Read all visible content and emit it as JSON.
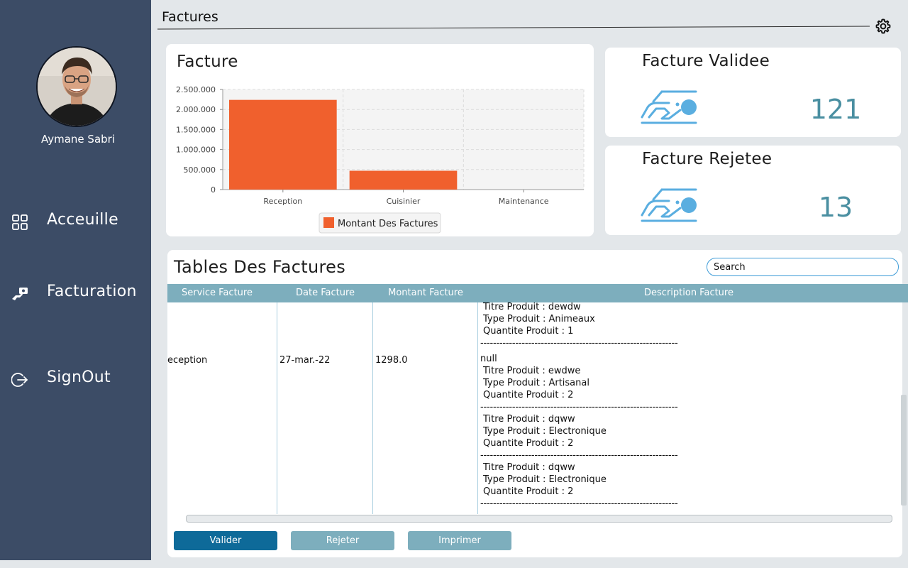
{
  "sidebar": {
    "user_name": "Aymane Sabri",
    "nav": [
      {
        "label": "Acceuille",
        "icon": "grid-icon"
      },
      {
        "label": "Facturation",
        "icon": "hand-money-icon"
      },
      {
        "label": "SignOut",
        "icon": "sign-out-icon"
      }
    ]
  },
  "header": {
    "title": "Factures",
    "settings_icon": "gear-icon"
  },
  "chart_card": {
    "title": "Facture"
  },
  "chart_data": {
    "type": "bar",
    "categories": [
      "Reception",
      "Cuisinier",
      "Maintenance"
    ],
    "series": [
      {
        "name": "Montant Des Factures",
        "values": [
          2240000,
          470000,
          0
        ],
        "color": "#f0602d"
      }
    ],
    "ylim": [
      0,
      2500000
    ],
    "yticks": [
      0,
      500000,
      1000000,
      1500000,
      2000000,
      2500000
    ],
    "ytick_labels": [
      "0",
      "500.000",
      "1.000.000",
      "1.500.000",
      "2.000.000",
      "2.500.000"
    ],
    "grid": true,
    "legend": "bottom-center"
  },
  "stats": {
    "valid": {
      "title": "Facture Validee",
      "value": "121",
      "icon": "invoice-hand-icon"
    },
    "reject": {
      "title": "Facture Rejetee",
      "value": "13",
      "icon": "invoice-hand-icon"
    }
  },
  "table": {
    "title": "Tables Des Factures",
    "search_placeholder": "Search",
    "columns": [
      "Service Facture",
      "Date Facture",
      "Montant Facture",
      "Description Facture"
    ],
    "row": {
      "service": "eception",
      "date": "27-mar.-22",
      "amount": "1298.0"
    },
    "description": {
      "top_lines": [
        "Titre Produit : dewdw",
        "Type Produit : Animeaux",
        "Quantite Produit : 1"
      ],
      "separator": "--------------------------------------------------------------",
      "null_text": "null",
      "items": [
        [
          "Titre Produit : ewdwe",
          "Type Produit : Artisanal",
          "Quantite Produit : 2"
        ],
        [
          "Titre Produit : dqww",
          "Type Produit : Electronique",
          "Quantite Produit : 2"
        ],
        [
          "Titre Produit : dqww",
          "Type Produit : Electronique",
          "Quantite Produit : 2"
        ]
      ]
    }
  },
  "buttons": {
    "validate": "Valider",
    "reject": "Rejeter",
    "print": "Imprimer"
  }
}
